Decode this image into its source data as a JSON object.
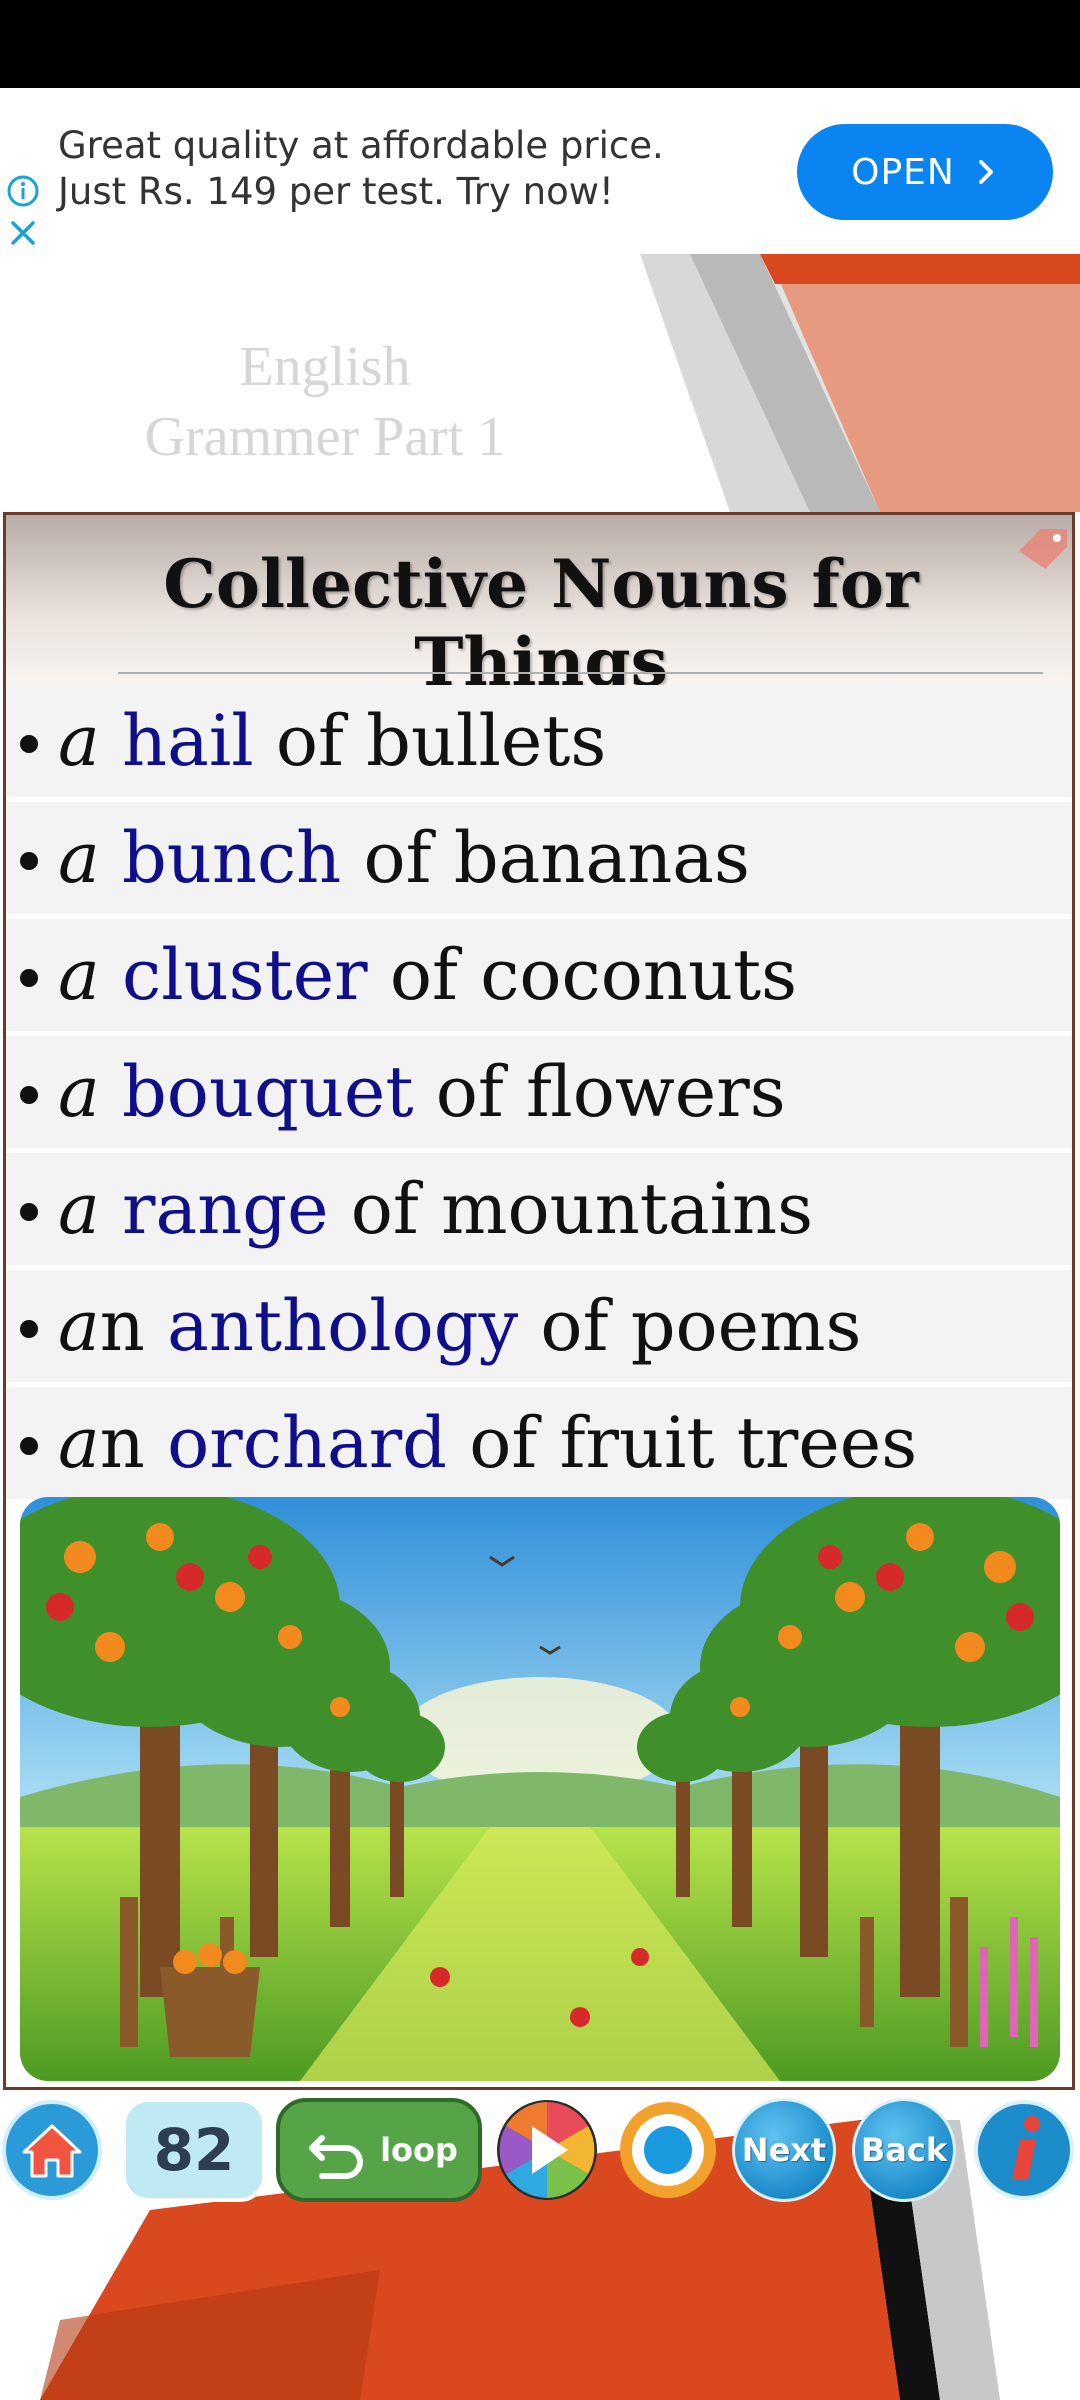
{
  "ad": {
    "line1": "Great quality at affordable price.",
    "line2": "Just Rs. 149 per test. Try now!",
    "open_label": "OPEN"
  },
  "slide": {
    "title_line1": "English",
    "title_line2": "Grammer Part 1",
    "heading": "Collective Nouns for Things"
  },
  "items": [
    {
      "article": "a",
      "article_rest": "",
      "keyword": "hail",
      "rest": "of bullets"
    },
    {
      "article": "a",
      "article_rest": "",
      "keyword": "bunch",
      "rest": "of bananas"
    },
    {
      "article": "a",
      "article_rest": "",
      "keyword": "cluster",
      "rest": "of coconuts"
    },
    {
      "article": "a",
      "article_rest": "",
      "keyword": "bouquet",
      "rest": "of flowers"
    },
    {
      "article": "a",
      "article_rest": "",
      "keyword": "range",
      "rest": "of mountains"
    },
    {
      "article": "a",
      "article_rest": "n",
      "keyword": "anthology",
      "rest": "of poems"
    },
    {
      "article": "a",
      "article_rest": "n",
      "keyword": "orchard",
      "rest": "of fruit trees"
    }
  ],
  "toolbar": {
    "page_number": "82",
    "loop_label": "loop",
    "next_label": "Next",
    "back_label": "Back"
  },
  "colors": {
    "keyword": "#0f0f8c",
    "ad_button": "#0a84f0",
    "loop_button": "#55a548",
    "accent_red": "#d9481f"
  }
}
